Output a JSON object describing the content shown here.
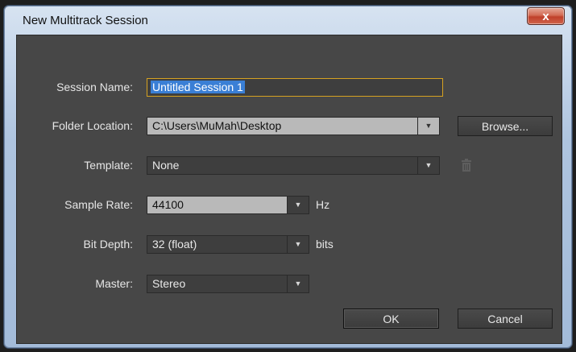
{
  "window": {
    "title": "New Multitrack Session",
    "close_label": "x"
  },
  "form": {
    "session_name_label": "Session Name:",
    "session_name_value": "Untitled Session 1",
    "folder_location_label": "Folder Location:",
    "folder_location_value": "C:\\Users\\MuMah\\Desktop",
    "browse_label": "Browse...",
    "template_label": "Template:",
    "template_value": "None",
    "sample_rate_label": "Sample Rate:",
    "sample_rate_value": "44100",
    "sample_rate_unit": "Hz",
    "bit_depth_label": "Bit Depth:",
    "bit_depth_value": "32 (float)",
    "bit_depth_unit": "bits",
    "master_label": "Master:",
    "master_value": "Stereo"
  },
  "buttons": {
    "ok_label": "OK",
    "cancel_label": "Cancel"
  },
  "icons": {
    "dropdown": "dropdown-arrow-icon",
    "trash": "trash-icon",
    "close": "close-icon"
  }
}
